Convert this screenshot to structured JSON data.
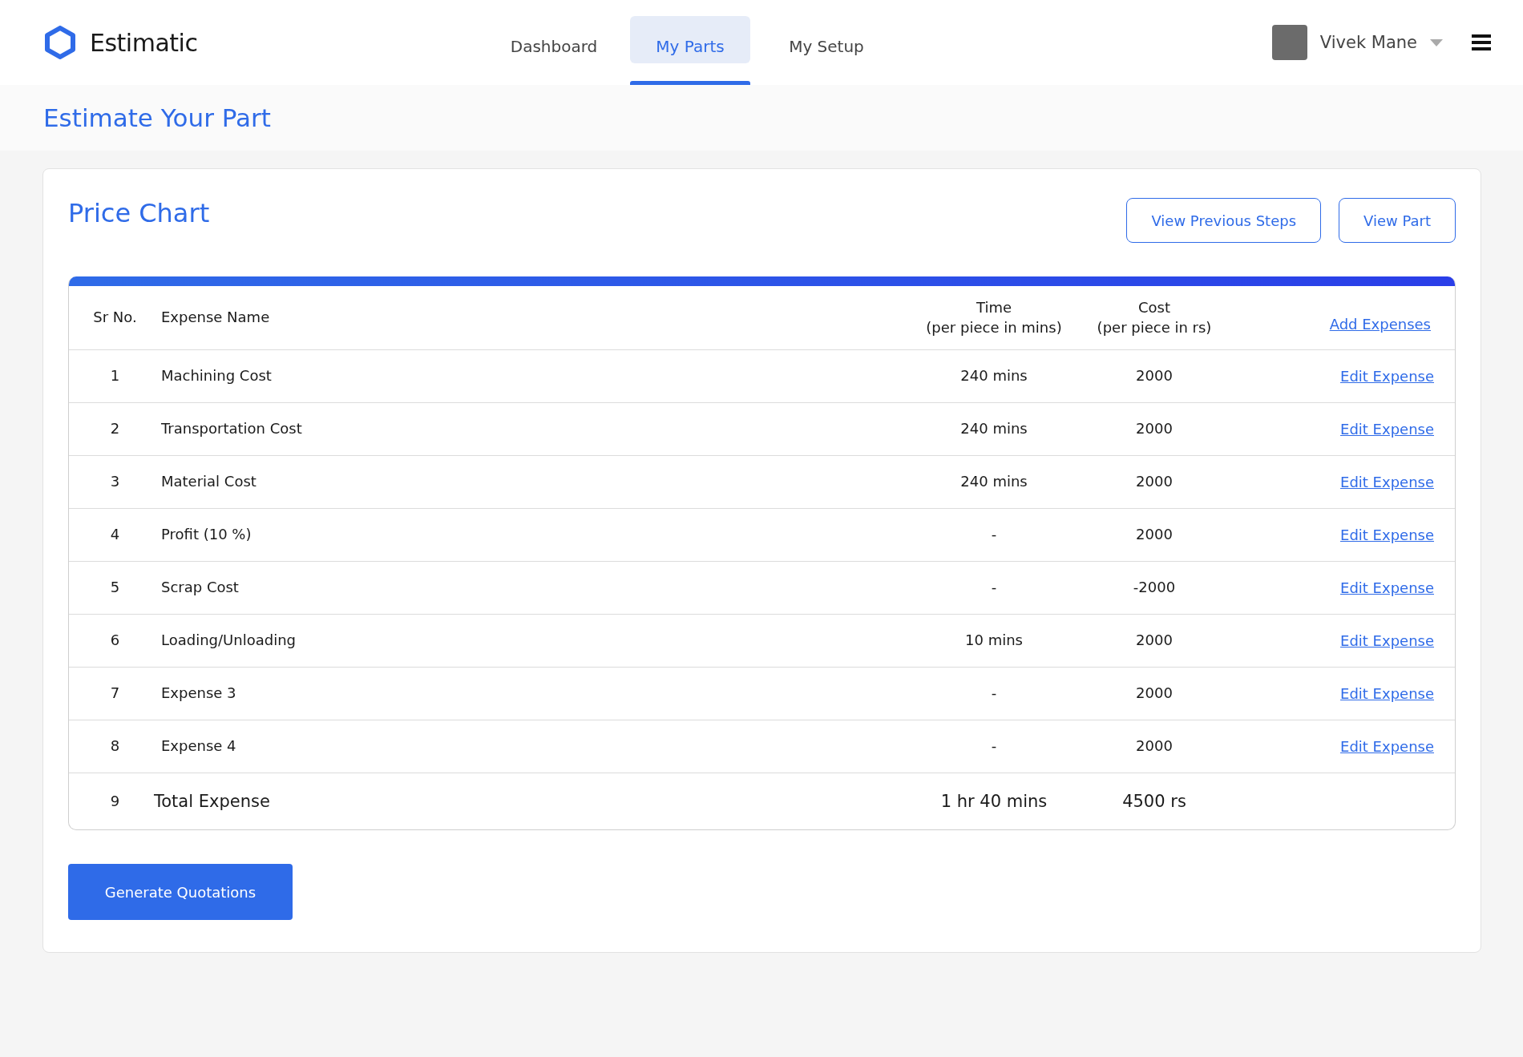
{
  "brand": {
    "name": "Estimatic"
  },
  "nav": [
    {
      "label": "Dashboard",
      "selected": false
    },
    {
      "label": "My Parts",
      "selected": true
    },
    {
      "label": "My Setup",
      "selected": false
    }
  ],
  "user": {
    "name": "Vivek Mane"
  },
  "page_title": "Estimate Your Part",
  "card": {
    "title": "Price Chart",
    "buttons": [
      "View Previous Steps",
      "View Part"
    ]
  },
  "table": {
    "columns": [
      "Sr No.",
      "Expense Name",
      "Time\n(per piece in mins)",
      "Cost\n(per piece in rs)"
    ],
    "header_action": "Add Expenses",
    "rows": [
      {
        "sr": "1",
        "name": "Machining Cost",
        "time": "240 mins",
        "cost": "2000",
        "action": "Edit Expense"
      },
      {
        "sr": "2",
        "name": "Transportation Cost",
        "time": "240 mins",
        "cost": "2000",
        "action": "Edit Expense"
      },
      {
        "sr": "3",
        "name": "Material Cost",
        "time": "240 mins",
        "cost": "2000",
        "action": "Edit Expense"
      },
      {
        "sr": "4",
        "name": "Profit (10 %)",
        "time": "-",
        "cost": "2000",
        "action": "Edit Expense"
      },
      {
        "sr": "5",
        "name": "Scrap Cost",
        "time": "-",
        "cost": "-2000",
        "action": "Edit Expense"
      },
      {
        "sr": "6",
        "name": "Loading/Unloading",
        "time": "10 mins",
        "cost": "2000",
        "action": "Edit Expense"
      },
      {
        "sr": "7",
        "name": "Expense 3",
        "time": "-",
        "cost": "2000",
        "action": "Edit Expense"
      },
      {
        "sr": "8",
        "name": "Expense 4",
        "time": "-",
        "cost": "2000",
        "action": "Edit Expense"
      }
    ],
    "total": {
      "sr": "9",
      "name": "Total Expense",
      "time": "1 hr 40 mins",
      "cost": "4500 rs"
    }
  },
  "primary_button": "Generate Quotations"
}
